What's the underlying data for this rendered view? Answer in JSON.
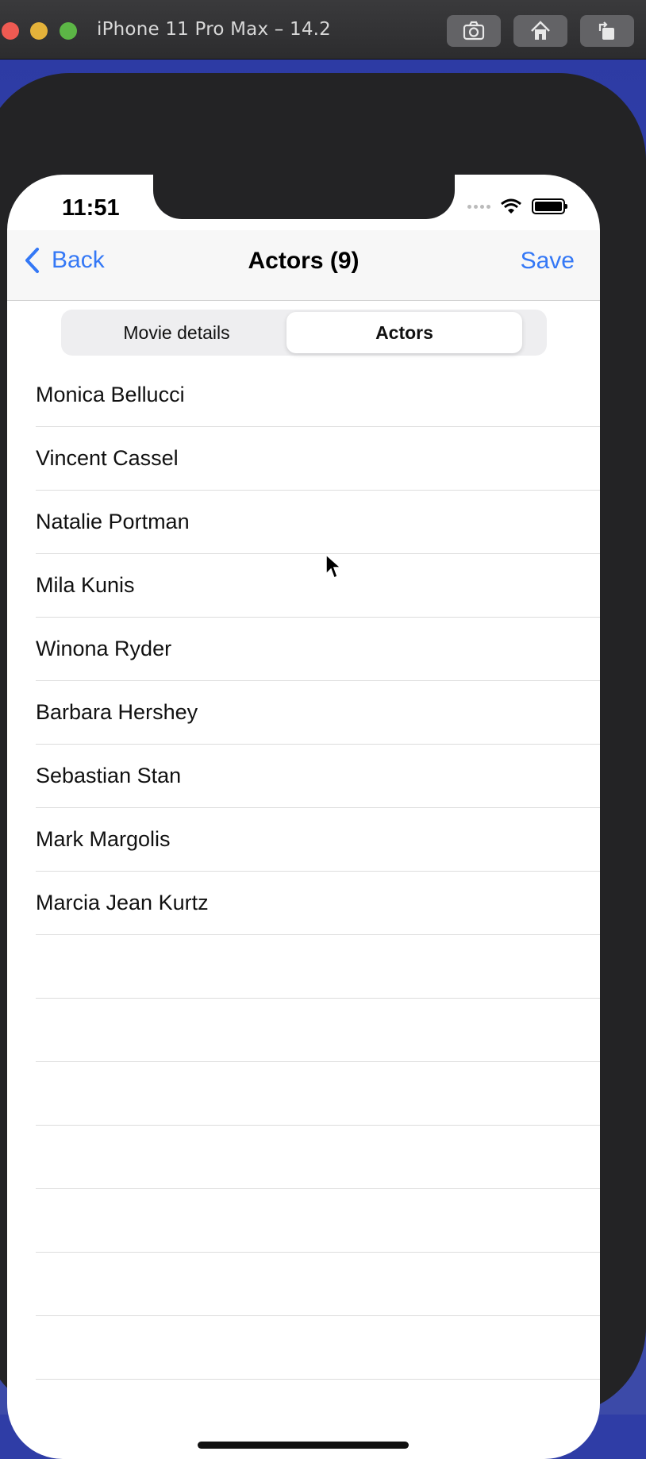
{
  "window": {
    "title": "iPhone 11 Pro Max – 14.2",
    "toolbar_icons": [
      "screenshot-icon",
      "home-icon",
      "rotate-icon"
    ]
  },
  "status_bar": {
    "time": "11:51"
  },
  "nav": {
    "back_label": "Back",
    "title": "Actors (9)",
    "save_label": "Save"
  },
  "segmented": {
    "options": [
      "Movie details",
      "Actors"
    ],
    "selected": "Actors"
  },
  "actors": [
    "Monica Bellucci",
    "Vincent Cassel",
    "Natalie Portman",
    "Mila Kunis",
    "Winona Ryder",
    "Barbara Hershey",
    "Sebastian Stan",
    "Mark Margolis",
    "Marcia Jean Kurtz"
  ],
  "colors": {
    "accent": "#3478f6",
    "desktop": "#2f3da6"
  }
}
